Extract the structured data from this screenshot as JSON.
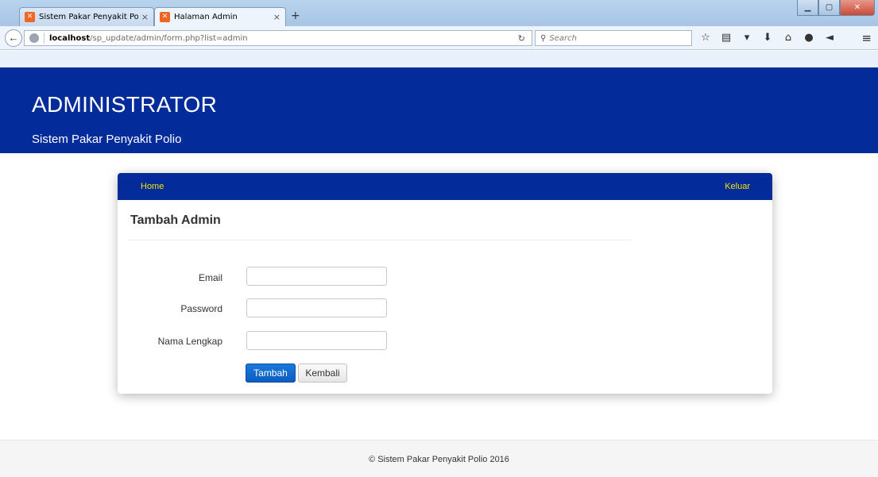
{
  "browser": {
    "tabs": [
      {
        "label": "Sistem Pakar Penyakit Polio",
        "close": "×"
      },
      {
        "label": "Halaman Admin",
        "close": "×"
      }
    ],
    "new_tab": "+",
    "url_host": "localhost",
    "url_path": "/sp_update/admin/form.php?list=admin",
    "search_placeholder": "Search",
    "icons": [
      "star-icon",
      "bookmarks-icon",
      "pocket-icon",
      "download-icon",
      "home-icon",
      "chat-icon",
      "send-icon",
      "menu-icon"
    ]
  },
  "header": {
    "title": "ADMINISTRATOR",
    "subtitle": "Sistem Pakar Penyakit Polio",
    "background": "#032b9a"
  },
  "nav": {
    "home": "Home",
    "logout": "Keluar",
    "link_color": "#f3e200"
  },
  "form": {
    "title": "Tambah Admin",
    "fields": [
      {
        "label": "Email",
        "value": ""
      },
      {
        "label": "Password",
        "value": ""
      },
      {
        "label": "Nama Lengkap",
        "value": ""
      }
    ],
    "submit_label": "Tambah",
    "back_label": "Kembali"
  },
  "footer": {
    "text": "© Sistem Pakar Penyakit Polio 2016"
  }
}
